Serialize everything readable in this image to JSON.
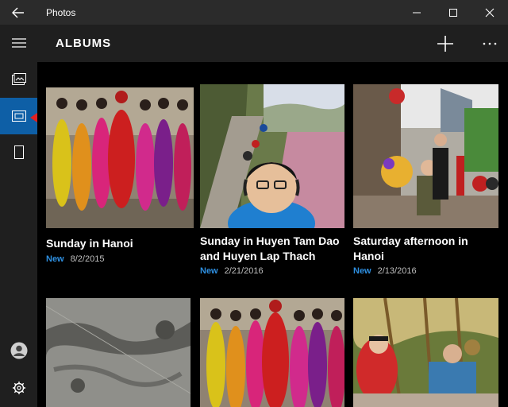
{
  "window": {
    "title": "Photos"
  },
  "header": {
    "title": "ALBUMS"
  },
  "sidebar": {
    "items": [
      {
        "icon": "hamburger-menu-icon"
      },
      {
        "icon": "collection-icon"
      },
      {
        "icon": "albums-icon"
      },
      {
        "icon": "folders-icon"
      },
      {
        "icon": "account-icon"
      },
      {
        "icon": "gear-icon"
      }
    ]
  },
  "albums": [
    {
      "title": "Sunday in Hanoi",
      "badge": "New",
      "date": "8/2/2015"
    },
    {
      "title": "Sunday in Huyen Tam Dao and Huyen Lap Thach",
      "badge": "New",
      "date": "2/21/2016"
    },
    {
      "title": "Saturday afternoon in Hanoi",
      "badge": "New",
      "date": "2/13/2016"
    }
  ],
  "colors": {
    "accent": "#0e5fa6",
    "new_badge": "#2e8fe0",
    "chrome": "#1f1f1f",
    "titlebar": "#2b2b2b",
    "arrow": "#e02020"
  }
}
